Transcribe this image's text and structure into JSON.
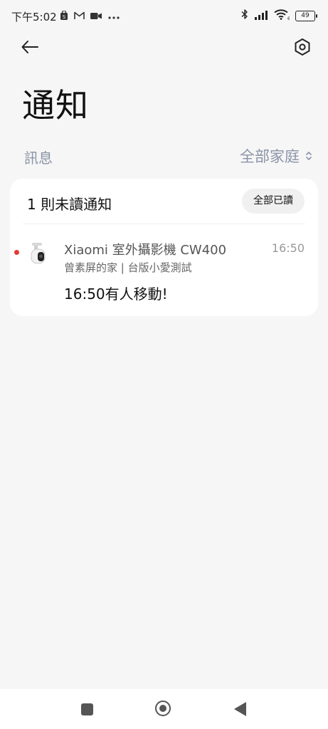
{
  "status_bar": {
    "time": "下午5:02",
    "left_icons": [
      "shopping-bag-icon",
      "gmail-icon",
      "video-camera-icon",
      "more-dots-icon"
    ],
    "right_icons": [
      "bluetooth-icon",
      "signal-icon",
      "wifi-icon"
    ],
    "battery": "49"
  },
  "header": {
    "title": "通知"
  },
  "filter": {
    "section_label": "訊息",
    "home_selector": "全部家庭"
  },
  "card": {
    "unread_title": "1 則未讀通知",
    "mark_all_read": "全部已讀",
    "notifications": [
      {
        "device": "Xiaomi 室外攝影機 CW400",
        "time": "16:50",
        "home": "曾素屏的家 | 台版小愛測試",
        "message": "16:50有人移動!",
        "unread": true
      }
    ]
  },
  "colors": {
    "background": "#f6f6f6",
    "card": "#ffffff",
    "accent_muted": "#8a93a6",
    "unread_dot": "#e53935"
  }
}
